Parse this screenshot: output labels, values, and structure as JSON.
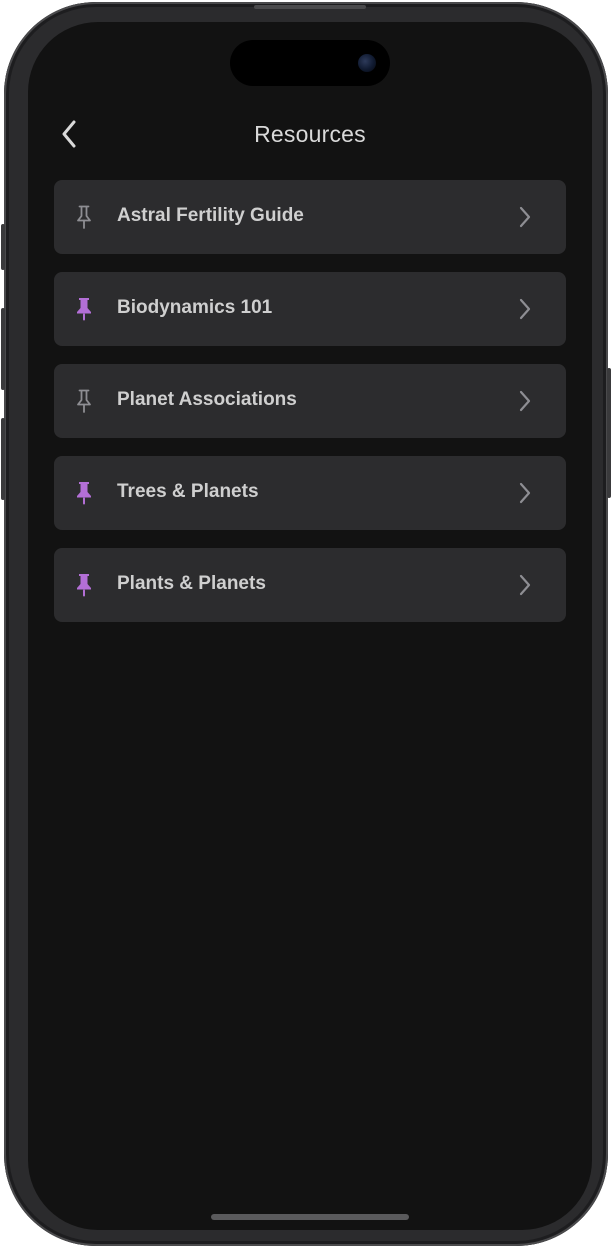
{
  "header": {
    "title": "Resources",
    "back_icon": "chevron-left-icon"
  },
  "resources": [
    {
      "label": "Astral Fertility Guide",
      "pinned": false
    },
    {
      "label": "Biodynamics 101",
      "pinned": true
    },
    {
      "label": "Planet Associations",
      "pinned": false
    },
    {
      "label": "Trees & Planets",
      "pinned": true
    },
    {
      "label": "Plants & Planets",
      "pinned": true
    }
  ],
  "colors": {
    "background": "#121212",
    "row_background": "#2c2c2e",
    "text": "#cfcfcf",
    "pin_active": "#b36fd6",
    "pin_inactive": "#8e8e93",
    "chevron": "#8e8e93"
  },
  "icons": {
    "pin": "pushpin-icon",
    "chevron": "chevron-right-icon"
  }
}
